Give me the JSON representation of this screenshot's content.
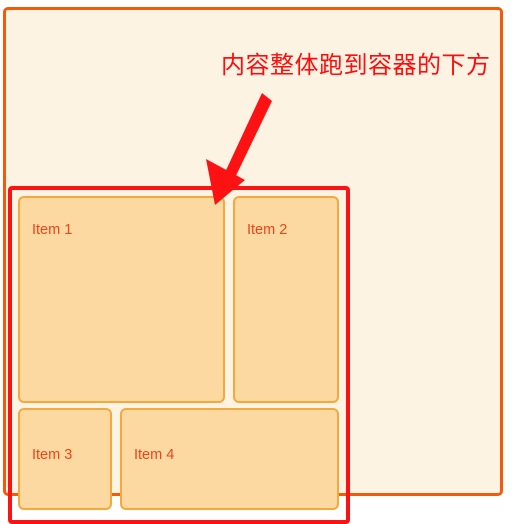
{
  "annotation": {
    "text": "内容整体跑到容器的下方",
    "text_color": "#FF0C0C",
    "arrow_color": "#FC1212",
    "arrow_icon": "arrow-down-left-icon"
  },
  "outer_container": {
    "border_color": "#F35A0A",
    "background_color": "#FDF3E3"
  },
  "items_wrapper": {
    "highlight_border_color": "#FC1212"
  },
  "items": [
    {
      "label": "Item 1",
      "fill": "#FBD9A1",
      "border": "#F5A93C",
      "text_color": "#F0431B"
    },
    {
      "label": "Item 2",
      "fill": "#FBD9A1",
      "border": "#F5A93C",
      "text_color": "#F0431B"
    },
    {
      "label": "Item 3",
      "fill": "#FBD9A1",
      "border": "#F5A93C",
      "text_color": "#F0431B"
    },
    {
      "label": "Item 4",
      "fill": "#FBD9A1",
      "border": "#F5A93C",
      "text_color": "#F0431B"
    }
  ]
}
